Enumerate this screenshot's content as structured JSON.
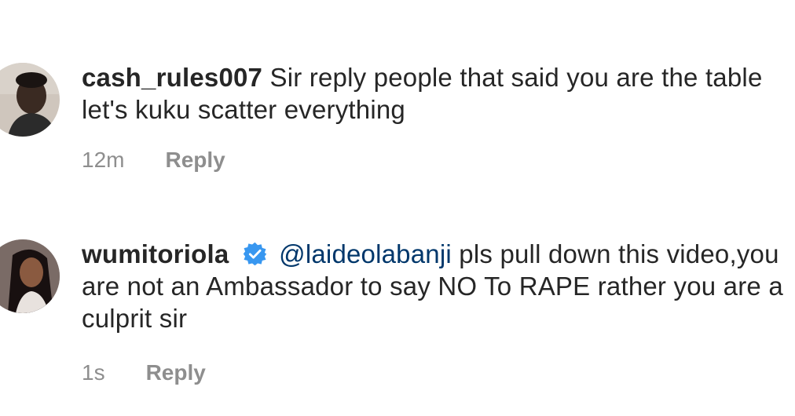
{
  "comments": [
    {
      "username": "cash_rules007",
      "verified": false,
      "mention": "",
      "text": "Sir reply people that said you are the table let's kuku scatter everything",
      "time": "12m",
      "reply_label": "Reply",
      "avatar_icon": "user-avatar-photo"
    },
    {
      "username": "wumitoriola",
      "verified": true,
      "verified_icon": "verified-badge-icon",
      "mention": "@laideolabanji",
      "text": "pls pull down this video,you are not an Ambassador to say NO To RAPE rather you are a culprit sir",
      "time": "1s",
      "reply_label": "Reply",
      "avatar_icon": "user-avatar-photo"
    }
  ],
  "colors": {
    "text": "#262626",
    "meta": "#8e8e8e",
    "mention": "#00376b",
    "verified": "#3897f0"
  }
}
